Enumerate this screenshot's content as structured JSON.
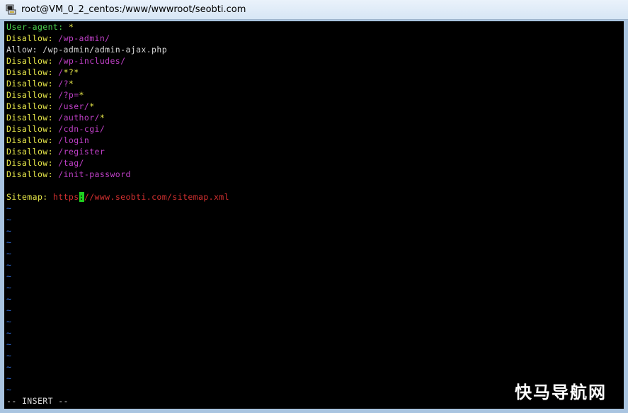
{
  "window": {
    "title": "root@VM_0_2_centos:/www/wwwroot/seobti.com"
  },
  "editor": {
    "lines": [
      [
        {
          "t": "User-agent: ",
          "c": "green"
        },
        {
          "t": "*",
          "c": "yellow"
        }
      ],
      [
        {
          "t": "Disallow: ",
          "c": "yellow"
        },
        {
          "t": "/wp-admin/",
          "c": "magenta"
        }
      ],
      [
        {
          "t": "Allow: /wp-admin/admin-ajax.php",
          "c": "white"
        }
      ],
      [
        {
          "t": "Disallow: ",
          "c": "yellow"
        },
        {
          "t": "/wp-includes/",
          "c": "magenta"
        }
      ],
      [
        {
          "t": "Disallow: ",
          "c": "yellow"
        },
        {
          "t": "/",
          "c": "magenta"
        },
        {
          "t": "*?*",
          "c": "yellow"
        }
      ],
      [
        {
          "t": "Disallow: ",
          "c": "yellow"
        },
        {
          "t": "/?",
          "c": "magenta"
        },
        {
          "t": "*",
          "c": "yellow"
        }
      ],
      [
        {
          "t": "Disallow: ",
          "c": "yellow"
        },
        {
          "t": "/?p=",
          "c": "magenta"
        },
        {
          "t": "*",
          "c": "yellow"
        }
      ],
      [
        {
          "t": "Disallow: ",
          "c": "yellow"
        },
        {
          "t": "/user/",
          "c": "magenta"
        },
        {
          "t": "*",
          "c": "yellow"
        }
      ],
      [
        {
          "t": "Disallow: ",
          "c": "yellow"
        },
        {
          "t": "/author/",
          "c": "magenta"
        },
        {
          "t": "*",
          "c": "yellow"
        }
      ],
      [
        {
          "t": "Disallow: ",
          "c": "yellow"
        },
        {
          "t": "/cdn-cgi/",
          "c": "magenta"
        }
      ],
      [
        {
          "t": "Disallow: ",
          "c": "yellow"
        },
        {
          "t": "/login",
          "c": "magenta"
        }
      ],
      [
        {
          "t": "Disallow: ",
          "c": "yellow"
        },
        {
          "t": "/register",
          "c": "magenta"
        }
      ],
      [
        {
          "t": "Disallow: ",
          "c": "yellow"
        },
        {
          "t": "/tag/",
          "c": "magenta"
        }
      ],
      [
        {
          "t": "Disallow: ",
          "c": "yellow"
        },
        {
          "t": "/init-password",
          "c": "magenta"
        }
      ],
      [],
      [
        {
          "t": "Sitemap: ",
          "c": "yellow"
        },
        {
          "t": "https",
          "c": "red"
        },
        {
          "t": ":",
          "c": "cursor"
        },
        {
          "t": "//www.seobti.com/sitemap.xml",
          "c": "red"
        }
      ]
    ],
    "empty_line_marker": "~",
    "empty_line_count": 17,
    "status_line": "-- INSERT --"
  },
  "watermark": "快马导航网",
  "colors": {
    "background": "#000000",
    "keyword": "#e8e84a",
    "path": "#c040c8",
    "url": "#d43030",
    "tilde": "#2f6fe0",
    "cursor": "#20d020"
  }
}
